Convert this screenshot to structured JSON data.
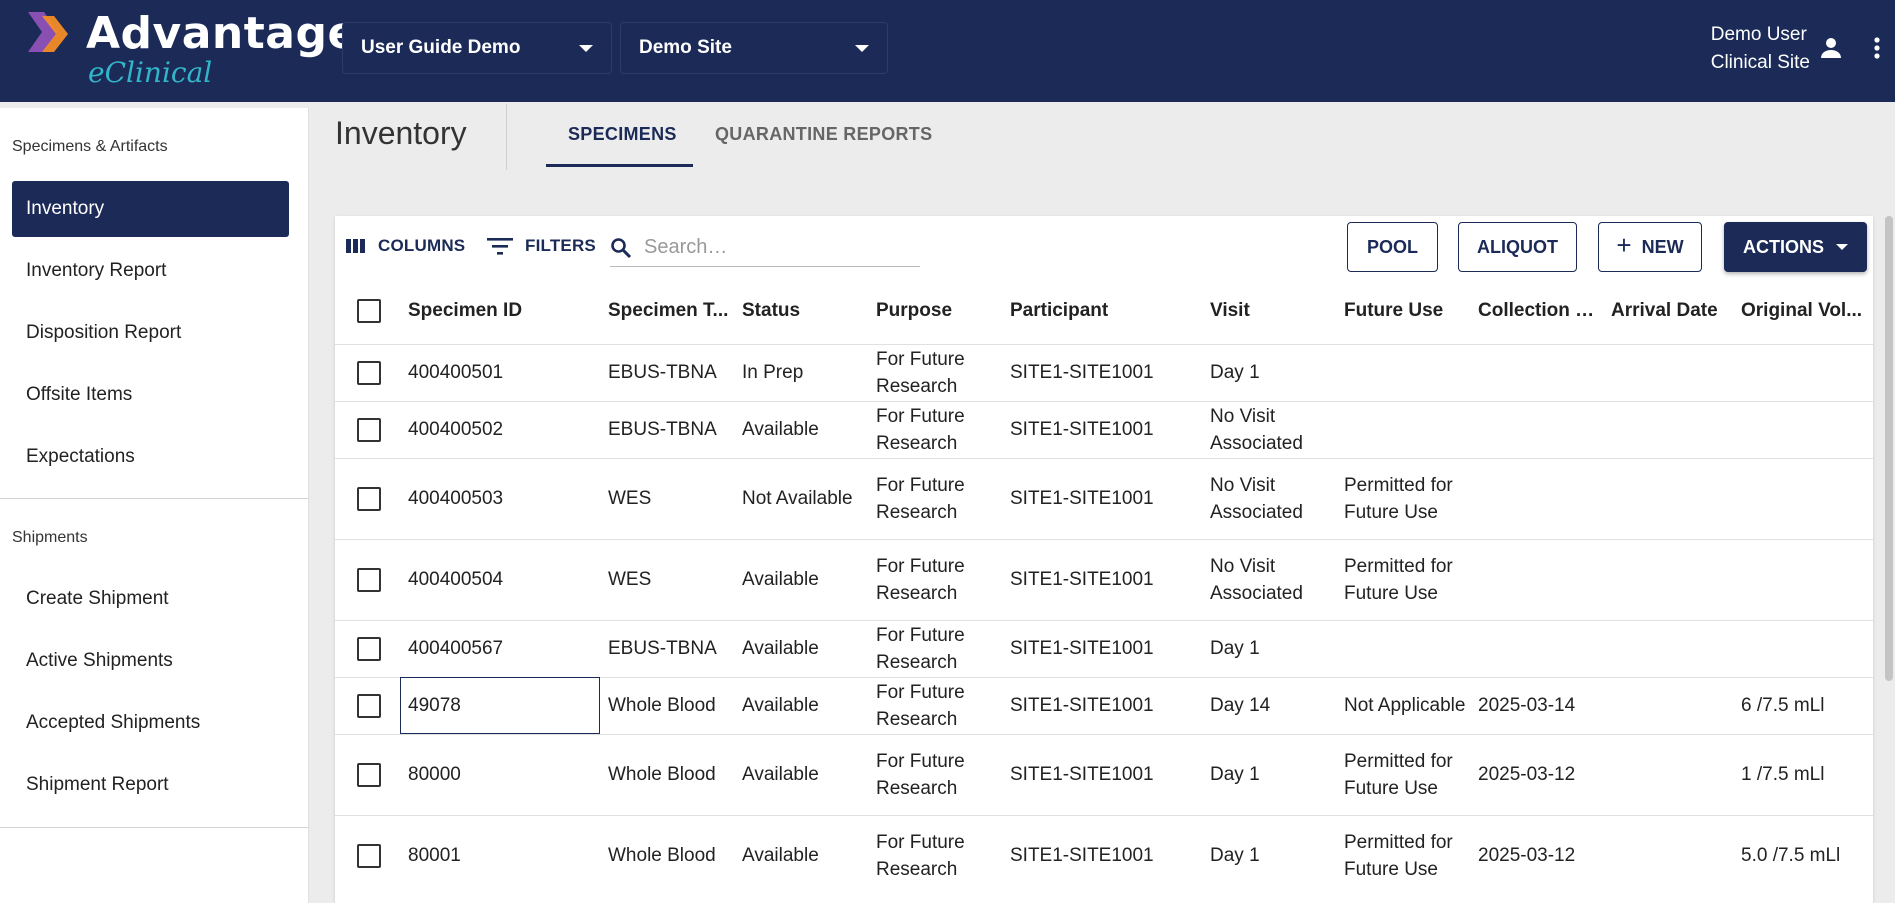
{
  "header": {
    "logo_title": "Advantage",
    "logo_subtitle": "eClinical",
    "study_select": "User Guide Demo",
    "site_select": "Demo Site",
    "user_name": "Demo User",
    "user_role": "Clinical Site"
  },
  "sidebar": {
    "section1": "Specimens & Artifacts",
    "items1": [
      "Inventory",
      "Inventory Report",
      "Disposition Report",
      "Offsite Items",
      "Expectations"
    ],
    "section2": "Shipments",
    "items2": [
      "Create Shipment",
      "Active Shipments",
      "Accepted Shipments",
      "Shipment Report"
    ],
    "active_item": "Inventory"
  },
  "main": {
    "title": "Inventory",
    "tabs": [
      {
        "label": "SPECIMENS",
        "active": true
      },
      {
        "label": "QUARANTINE REPORTS",
        "active": false
      }
    ],
    "toolbar": {
      "columns_label": "COLUMNS",
      "filters_label": "FILTERS",
      "search_placeholder": "Search…",
      "pool_label": "POOL",
      "aliquot_label": "ALIQUOT",
      "new_label": "NEW",
      "actions_label": "ACTIONS"
    },
    "table": {
      "headers": [
        "Specimen ID",
        "Specimen T...",
        "Status",
        "Purpose",
        "Participant",
        "Visit",
        "Future Use",
        "Collection D...",
        "Arrival Date",
        "Original Vol..."
      ],
      "rows": [
        [
          "400400501",
          "EBUS-TBNA",
          "In Prep",
          "For Future Research",
          "SITE1-SITE1001",
          "Day 1",
          "",
          "",
          "",
          ""
        ],
        [
          "400400502",
          "EBUS-TBNA",
          "Available",
          "For Future Research",
          "SITE1-SITE1001",
          "No Visit Associated",
          "",
          "",
          "",
          ""
        ],
        [
          "400400503",
          "WES",
          "Not Available",
          "For Future Research",
          "SITE1-SITE1001",
          "No Visit Associated",
          "Permitted for Future Use",
          "",
          "",
          ""
        ],
        [
          "400400504",
          "WES",
          "Available",
          "For Future Research",
          "SITE1-SITE1001",
          "No Visit Associated",
          "Permitted for Future Use",
          "",
          "",
          ""
        ],
        [
          "400400567",
          "EBUS-TBNA",
          "Available",
          "For Future Research",
          "SITE1-SITE1001",
          "Day 1",
          "",
          "",
          "",
          ""
        ],
        [
          "49078",
          "Whole Blood",
          "Available",
          "For Future Research",
          "SITE1-SITE1001",
          "Day 14",
          "Not Applicable",
          "2025-03-14",
          "",
          "6 /7.5 mLl"
        ],
        [
          "80000",
          "Whole Blood",
          "Available",
          "For Future Research",
          "SITE1-SITE1001",
          "Day 1",
          "Permitted for Future Use",
          "2025-03-12",
          "",
          "1 /7.5 mLl"
        ],
        [
          "80001",
          "Whole Blood",
          "Available",
          "For Future Research",
          "SITE1-SITE1001",
          "Day 1",
          "Permitted for Future Use",
          "2025-03-12",
          "",
          "5.0 /7.5 mLl"
        ]
      ]
    }
  },
  "colors": {
    "navy": "#1b2a57",
    "teal": "#33b5c9",
    "logo_orange": "#f28c28",
    "logo_purple": "#8a4fb3"
  },
  "icons": [
    "user-icon",
    "kebab-menu-icon",
    "columns-icon",
    "filter-icon",
    "search-icon",
    "plus-icon",
    "caret-down-icon",
    "checkbox-icon"
  ]
}
